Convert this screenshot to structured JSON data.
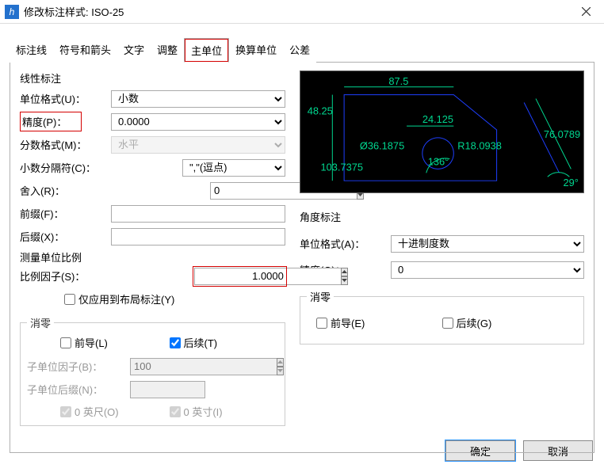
{
  "window": {
    "title": "修改标注样式: ISO-25"
  },
  "tabs": [
    "标注线",
    "符号和箭头",
    "文字",
    "调整",
    "主单位",
    "换算单位",
    "公差"
  ],
  "linear": {
    "legend": "线性标注",
    "unit_format_label": "单位格式(U)：",
    "unit_format_value": "小数",
    "precision_label": "精度(P)：",
    "precision_value": "0.0000",
    "fraction_label": "分数格式(M)：",
    "fraction_value": "水平",
    "decimal_sep_label": "小数分隔符(C)：",
    "decimal_sep_value": "\",\"(逗点)",
    "round_label": "舍入(R)：",
    "round_value": "0",
    "prefix_label": "前缀(F)：",
    "prefix_value": "",
    "suffix_label": "后缀(X)：",
    "suffix_value": "",
    "scale_legend": "测量单位比例",
    "scale_label": "比例因子(S)：",
    "scale_value": "1.0000",
    "layout_only": "仅应用到布局标注(Y)"
  },
  "suppress": {
    "legend": "消零",
    "leading": "前导(L)",
    "trailing": "后续(T)",
    "subfactor_label": "子单位因子(B)：",
    "subfactor_value": "100",
    "subsuffix_label": "子单位后缀(N)：",
    "subsuffix_value": "",
    "feet": "0 英尺(O)",
    "inches": "0 英寸(I)"
  },
  "preview_labels": {
    "top": "87.5",
    "left": "48.25",
    "mid": "24.125",
    "right": "76.0789",
    "dia": "Ø36.1875",
    "rad": "R18.0938",
    "bl": "103.7375",
    "ang1": "136°",
    "ang2": "29°"
  },
  "angular": {
    "legend": "角度标注",
    "unit_label": "单位格式(A)：",
    "unit_value": "十进制度数",
    "precision_label": "精度(O)：",
    "precision_value": "0",
    "suppress_legend": "消零",
    "leading": "前导(E)",
    "trailing": "后续(G)"
  },
  "buttons": {
    "ok": "确定",
    "cancel": "取消"
  }
}
